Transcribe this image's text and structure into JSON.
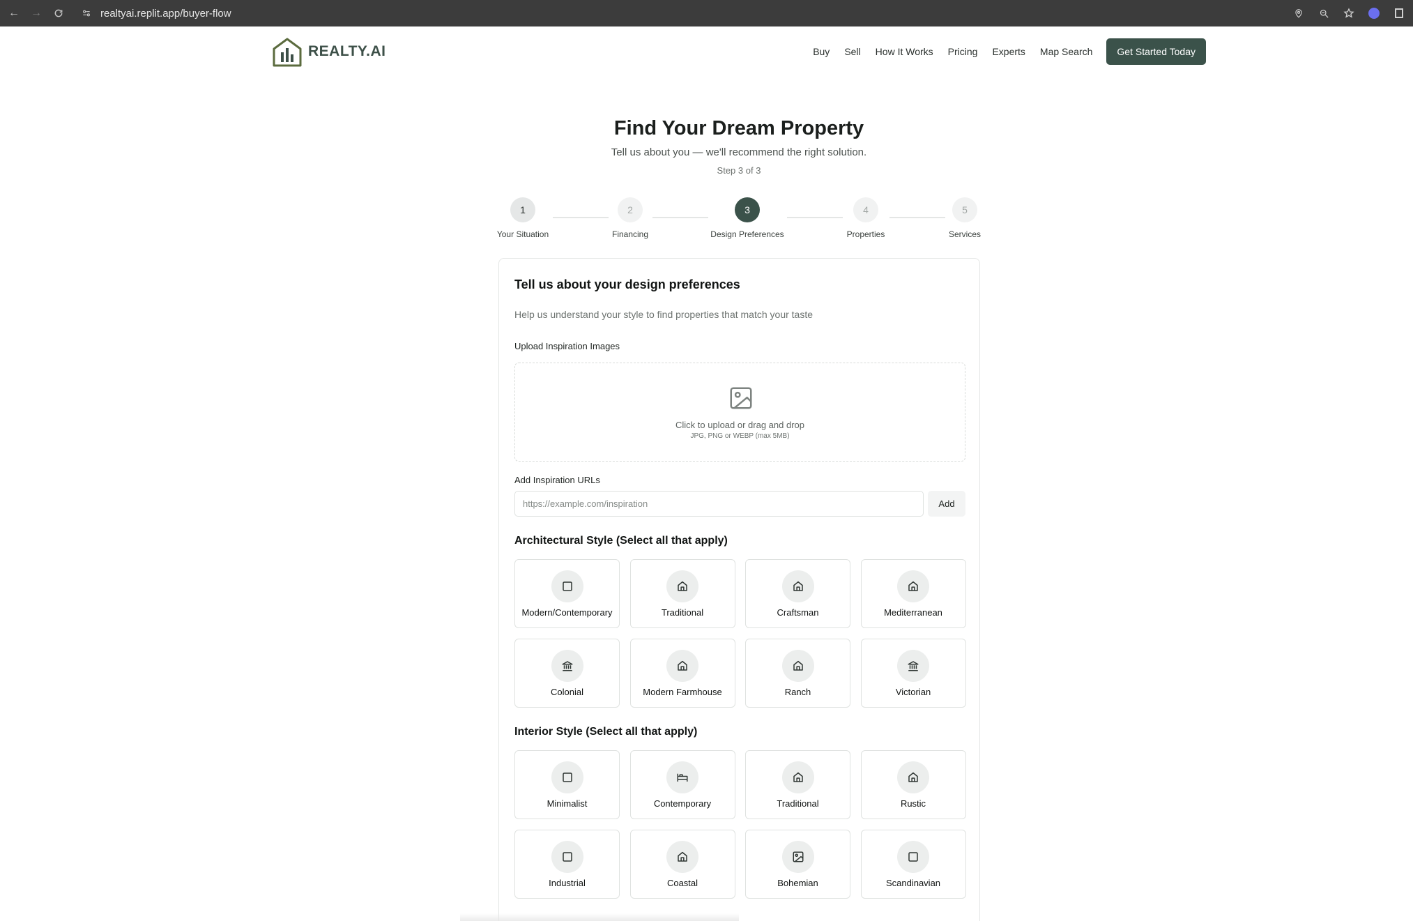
{
  "browser": {
    "url": "realtyai.replit.app/buyer-flow"
  },
  "header": {
    "logo_text": "REALTY.AI",
    "nav": [
      "Buy",
      "Sell",
      "How It Works",
      "Pricing",
      "Experts",
      "Map Search"
    ],
    "cta": "Get Started Today"
  },
  "hero": {
    "title": "Find Your Dream Property",
    "subtitle": "Tell us about you — we'll recommend the right solution.",
    "step_text": "Step 3 of 3"
  },
  "stepper": [
    {
      "num": "1",
      "label": "Your Situation",
      "state": "done"
    },
    {
      "num": "2",
      "label": "Financing",
      "state": "upcoming"
    },
    {
      "num": "3",
      "label": "Design Preferences",
      "state": "active"
    },
    {
      "num": "4",
      "label": "Properties",
      "state": "upcoming"
    },
    {
      "num": "5",
      "label": "Services",
      "state": "upcoming"
    }
  ],
  "card": {
    "title": "Tell us about your design preferences",
    "description": "Help us understand your style to find properties that match your taste",
    "upload": {
      "label": "Upload Inspiration Images",
      "prompt": "Click to upload or drag and drop",
      "hint": "JPG, PNG or WEBP (max 5MB)"
    },
    "urls": {
      "label": "Add Inspiration URLs",
      "placeholder": "https://example.com/inspiration",
      "add_label": "Add"
    },
    "architectural": {
      "heading": "Architectural Style (Select all that apply)",
      "options": [
        {
          "label": "Modern/Contemporary",
          "icon": "square-icon"
        },
        {
          "label": "Traditional",
          "icon": "home-icon"
        },
        {
          "label": "Craftsman",
          "icon": "home-icon"
        },
        {
          "label": "Mediterranean",
          "icon": "home-icon"
        },
        {
          "label": "Colonial",
          "icon": "landmark-icon"
        },
        {
          "label": "Modern Farmhouse",
          "icon": "home-icon"
        },
        {
          "label": "Ranch",
          "icon": "home-icon"
        },
        {
          "label": "Victorian",
          "icon": "landmark-icon"
        }
      ]
    },
    "interior": {
      "heading": "Interior Style (Select all that apply)",
      "options": [
        {
          "label": "Minimalist",
          "icon": "square-icon"
        },
        {
          "label": "Contemporary",
          "icon": "bed-icon"
        },
        {
          "label": "Traditional",
          "icon": "home-icon"
        },
        {
          "label": "Rustic",
          "icon": "home-icon"
        },
        {
          "label": "Industrial",
          "icon": "square-icon"
        },
        {
          "label": "Coastal",
          "icon": "home-icon"
        },
        {
          "label": "Bohemian",
          "icon": "image-icon"
        },
        {
          "label": "Scandinavian",
          "icon": "square-icon"
        }
      ]
    }
  },
  "colors": {
    "brand": "#3b524a",
    "logo": "#3d5048"
  }
}
